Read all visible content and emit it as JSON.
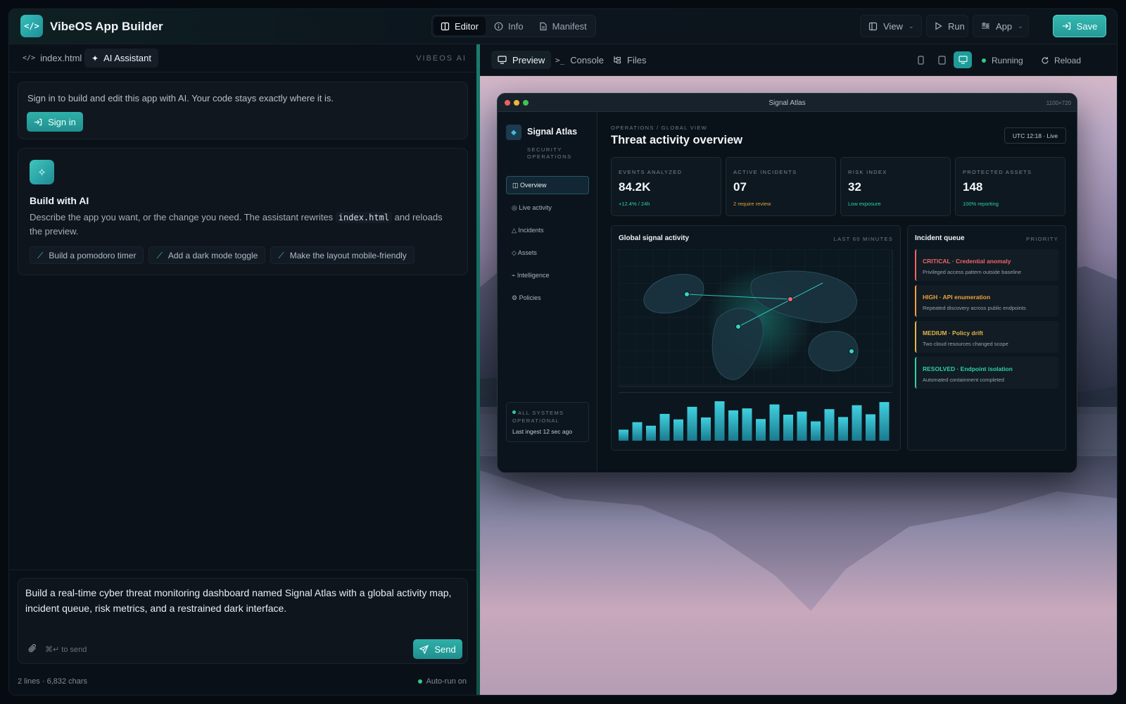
{
  "topbar": {
    "logo_glyph": "</>",
    "title": "VibeOS App Builder",
    "tabs": [
      {
        "label": "Editor",
        "icon": "book-icon",
        "active": true
      },
      {
        "label": "Info",
        "icon": "info-icon",
        "active": false
      },
      {
        "label": "Manifest",
        "icon": "file-icon",
        "active": false
      }
    ],
    "view_label": "View",
    "run_label": "Run",
    "app_label": "App",
    "save_label": "Save"
  },
  "left": {
    "tabs": [
      {
        "label": "index.html",
        "icon": "code-icon",
        "active": false
      },
      {
        "label": "AI Assistant",
        "icon": "sparkle-icon",
        "active": true
      }
    ],
    "brand_tag": "VIBEOS AI",
    "signin_card": {
      "message": "Sign in to build and edit this app with AI. Your code stays exactly where it is.",
      "button": "Sign in"
    },
    "build_card": {
      "title": "Build with AI",
      "desc_pre": "Describe the app you want, or the change you need. The assistant rewrites ",
      "desc_code": "index.html",
      "desc_post": " and reloads the preview.",
      "suggestions": [
        "Build a pomodoro timer",
        "Add a dark mode toggle",
        "Make the layout mobile-friendly"
      ]
    },
    "composer": {
      "text": "Build a real-time cyber threat monitoring dashboard named Signal Atlas with a global activity map, incident queue, risk metrics, and a restrained dark interface.",
      "hint": "⌘↵ to send",
      "send": "Send"
    },
    "status": {
      "left": "2 lines · 6,832 chars",
      "right": "Auto-run on"
    }
  },
  "right": {
    "tabs": [
      {
        "label": "Preview",
        "icon": "monitor-icon",
        "active": true
      },
      {
        "label": "Console",
        "icon": "terminal-icon",
        "active": false
      },
      {
        "label": "Files",
        "icon": "folder-tree-icon",
        "active": false
      }
    ],
    "devices": [
      "phone-icon",
      "tablet-icon",
      "desktop-icon"
    ],
    "active_device": "desktop-icon",
    "running": "Running",
    "reload": "Reload"
  },
  "preview": {
    "window_title": "Signal Atlas",
    "window_size": "1100×720",
    "brand": "Signal Atlas",
    "brand_sub": "SECURITY OPERATIONS",
    "nav": [
      {
        "label": "◫ Overview",
        "active": true
      },
      {
        "label": "◎ Live activity",
        "active": false
      },
      {
        "label": "△ Incidents",
        "active": false
      },
      {
        "label": "◇ Assets",
        "active": false
      },
      {
        "label": "⌁ Intelligence",
        "active": false
      },
      {
        "label": "⚙ Policies",
        "active": false
      }
    ],
    "system_status": "ALL SYSTEMS OPERATIONAL",
    "last_ingest": "Last ingest 12 sec ago",
    "breadcrumb": "OPERATIONS / GLOBAL VIEW",
    "heading": "Threat activity overview",
    "live_badge": "UTC 12:18 · Live",
    "kpis": [
      {
        "label": "EVENTS ANALYZED",
        "value": "84.2K",
        "note": "+12.4% / 24h",
        "note_color": "#2fd0a8"
      },
      {
        "label": "ACTIVE INCIDENTS",
        "value": "07",
        "note": "2 require review",
        "note_color": "#e0a23c"
      },
      {
        "label": "RISK INDEX",
        "value": "32",
        "note": "Low exposure",
        "note_color": "#2fd0a8"
      },
      {
        "label": "PROTECTED ASSETS",
        "value": "148",
        "note": "100% reporting",
        "note_color": "#2fd0a8"
      }
    ],
    "map_title": "Global signal activity",
    "map_range": "LAST 60 MINUTES",
    "activity_bars": [
      0.28,
      0.47,
      0.38,
      0.68,
      0.54,
      0.86,
      0.59,
      1.0,
      0.77,
      0.82,
      0.55,
      0.92,
      0.66,
      0.74,
      0.49,
      0.8,
      0.6,
      0.9,
      0.67,
      0.98
    ],
    "queue_title": "Incident queue",
    "queue_sort": "PRIORITY",
    "incidents": [
      {
        "title": "CRITICAL · Credential anomaly",
        "desc": "Privileged access pattern outside baseline",
        "color": "#f0636a"
      },
      {
        "title": "HIGH · API enumeration",
        "desc": "Repeated discovery across public endpoints",
        "color": "#f0a23a"
      },
      {
        "title": "MEDIUM · Policy drift",
        "desc": "Two cloud resources changed scope",
        "color": "#e5b548"
      },
      {
        "title": "RESOLVED · Endpoint isolation",
        "desc": "Automated containment completed",
        "color": "#2fd0a8"
      }
    ]
  }
}
